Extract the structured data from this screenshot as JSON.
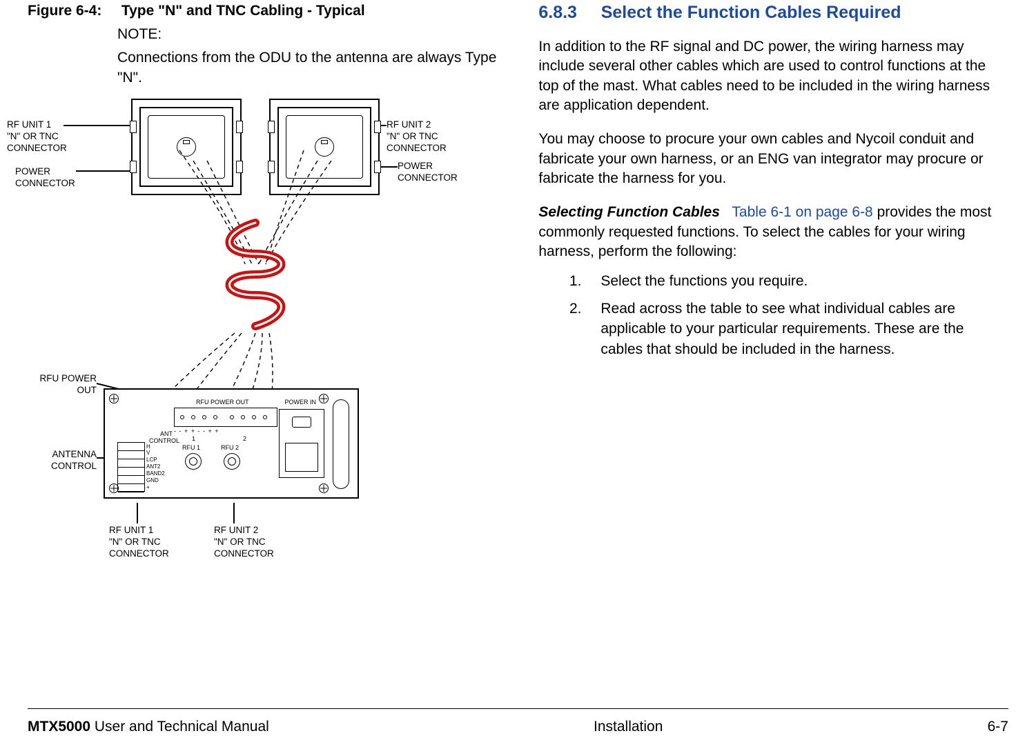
{
  "figure": {
    "label": "Figure 6-4:",
    "title": "Type \"N\" and TNC Cabling - Typical",
    "note_label": "NOTE:",
    "note_text": "Connections from the ODU to the antenna are always Type \"N\"."
  },
  "callouts": {
    "rf1_top": "RF UNIT 1\n\"N\" OR TNC\nCONNECTOR",
    "rf2_top": "RF UNIT 2\n\"N\" OR TNC\nCONNECTOR",
    "power_left": "POWER\nCONNECTOR",
    "power_right": "POWER\nCONNECTOR",
    "rfu_power_out_callout": "RFU POWER\nOUT",
    "antenna_control": "ANTENNA\nCONTROL",
    "rf1_bottom": "RF UNIT 1\n\"N\" OR TNC\nCONNECTOR",
    "rf2_bottom": "RF UNIT 2\n\"N\" OR TNC\nCONNECTOR"
  },
  "controller_labels": {
    "rfu_power_out": "RFU POWER OUT",
    "power_in": "POWER IN",
    "ant_control": "ANT\nCONTROL",
    "rfu1": "RFU 1",
    "rfu2": "RFU 2",
    "one": "1",
    "two": "2",
    "polarity": "-   -  +  +     -   -  +  +",
    "terminal_rows": [
      "H",
      "V",
      "LCP",
      "ANT2",
      "BAND2",
      "GND",
      "+"
    ]
  },
  "right": {
    "section_number": "6.8.3",
    "section_title": "Select the Function Cables Required",
    "p1": "In addition to the RF signal and DC power, the wiring harness may include several other cables which are used to control functions at the top of the mast.  What cables need to be included in the wiring harness are application dependent.",
    "p2": "You may choose to procure your own cables and Nycoil conduit and fabricate your own harness, or an ENG van integrator may procure or fabricate the harness for you.",
    "p3_runin": "Selecting Function Cables",
    "p3_link": "Table 6-1 on page 6-8",
    "p3_rest_a": " provides the most commonly requested functions.  To select the cables for your wiring harness, perform the following:",
    "list": [
      "Select the functions you require.",
      "Read across the table to see what individual cables are applicable to your particular requirements.  These are the cables that should be included in the harness."
    ]
  },
  "footer": {
    "left_bold": "MTX5000",
    "left_rest": " User and Technical Manual",
    "center": "Installation",
    "right": "6-7"
  }
}
